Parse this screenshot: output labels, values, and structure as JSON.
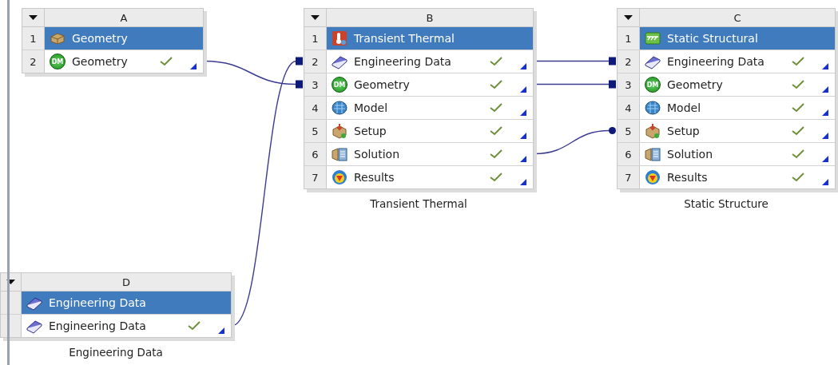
{
  "systems": [
    {
      "letter": "A",
      "title": {
        "kind": "box",
        "label": "Geometry"
      },
      "rows": [
        {
          "number": "1"
        },
        {
          "kind": "dm",
          "number": "2",
          "badge": "DM",
          "label": "Geometry",
          "checked": true
        }
      ]
    },
    {
      "letter": "B",
      "caption": "Transient Thermal",
      "title": {
        "kind": "thermal",
        "label": "Transient Thermal"
      },
      "rows": [
        {
          "number": "1"
        },
        {
          "kind": "book",
          "number": "2",
          "label": "Engineering Data",
          "checked": true,
          "link": {
            "kind": "share"
          }
        },
        {
          "kind": "dm",
          "number": "3",
          "badge": "DM",
          "label": "Geometry",
          "checked": true,
          "link": {
            "kind": "share"
          }
        },
        {
          "kind": "mesh",
          "number": "4",
          "label": "Model",
          "checked": true
        },
        {
          "kind": "setup",
          "number": "5",
          "label": "Setup",
          "checked": true
        },
        {
          "kind": "solution",
          "number": "6",
          "label": "Solution",
          "checked": true
        },
        {
          "kind": "results",
          "number": "7",
          "label": "Results",
          "checked": true
        }
      ]
    },
    {
      "letter": "C",
      "caption": "Static Structure",
      "title": {
        "kind": "structural",
        "label": "Static Structural"
      },
      "rows": [
        {
          "number": "1"
        },
        {
          "kind": "book",
          "number": "2",
          "label": "Engineering Data",
          "checked": true,
          "link": {
            "kind": "share"
          }
        },
        {
          "kind": "dm",
          "number": "3",
          "badge": "DM",
          "label": "Geometry",
          "checked": true,
          "link": {
            "kind": "share"
          }
        },
        {
          "kind": "mesh",
          "number": "4",
          "label": "Model",
          "checked": true
        },
        {
          "kind": "setup",
          "number": "5",
          "label": "Setup",
          "checked": true,
          "link": {
            "kind": "transfer"
          }
        },
        {
          "kind": "solution",
          "number": "6",
          "label": "Solution",
          "checked": true
        },
        {
          "kind": "results",
          "number": "7",
          "label": "Results",
          "checked": true
        }
      ]
    },
    {
      "letter": "D",
      "caption": "Engineering Data",
      "title": {
        "kind": "book",
        "label": "Engineering Data"
      },
      "rows": [
        {},
        {
          "kind": "book",
          "label": "Engineering Data",
          "checked": true
        }
      ]
    }
  ]
}
